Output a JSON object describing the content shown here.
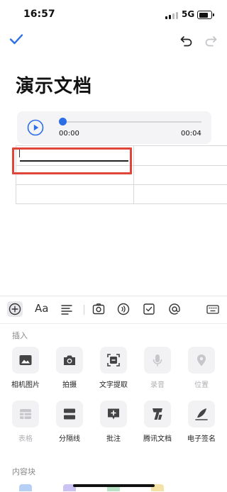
{
  "status_bar": {
    "time": "16:57",
    "network": "5G"
  },
  "document": {
    "title": "演示文档"
  },
  "audio": {
    "current": "00:00",
    "duration": "00:04",
    "progress": 0
  },
  "insert_panel": {
    "section_insert": "插入",
    "row1": [
      {
        "label": "相机图片",
        "icon": "image-icon",
        "enabled": true
      },
      {
        "label": "拍摄",
        "icon": "camera-icon",
        "enabled": true
      },
      {
        "label": "文字提取",
        "icon": "text-extract-icon",
        "enabled": true
      },
      {
        "label": "录音",
        "icon": "mic-icon",
        "enabled": false
      },
      {
        "label": "位置",
        "icon": "location-icon",
        "enabled": false
      }
    ],
    "row2": [
      {
        "label": "表格",
        "icon": "table-icon",
        "enabled": false
      },
      {
        "label": "分隔线",
        "icon": "divider-icon",
        "enabled": true
      },
      {
        "label": "批注",
        "icon": "comment-icon",
        "enabled": true
      },
      {
        "label": "腾讯文档",
        "icon": "tencent-docs-icon",
        "enabled": true
      },
      {
        "label": "电子签名",
        "icon": "signature-icon",
        "enabled": true
      }
    ],
    "section_blocks": "内容块"
  },
  "format_bar": {
    "font_label": "Aa",
    "items": [
      "add-icon",
      "font-icon",
      "align-icon",
      "image-icon",
      "voice-icon",
      "checkbox-icon",
      "mention-icon",
      "keyboard-icon"
    ]
  },
  "colors": {
    "accent": "#2b6ee8",
    "highlight_box": "#e0453a"
  }
}
